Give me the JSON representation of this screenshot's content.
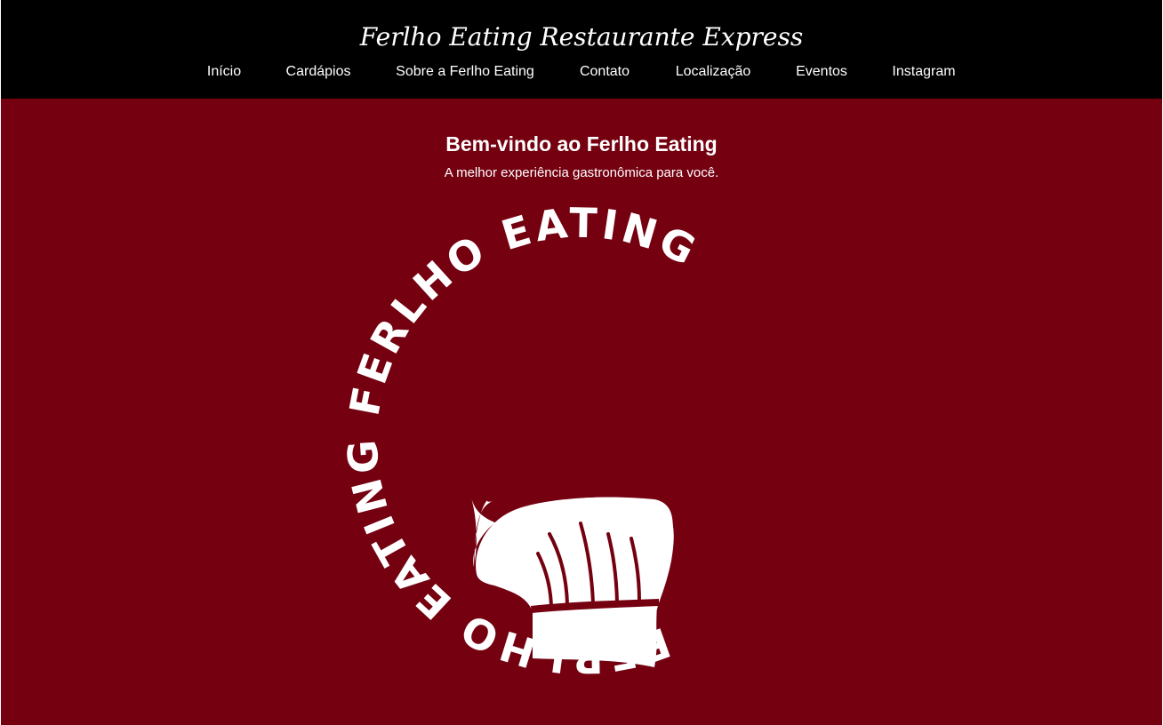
{
  "header": {
    "site_title": "Ferlho Eating Restaurante Express",
    "nav": [
      {
        "label": "Início"
      },
      {
        "label": "Cardápios"
      },
      {
        "label": "Sobre a Ferlho Eating"
      },
      {
        "label": "Contato"
      },
      {
        "label": "Localização"
      },
      {
        "label": "Eventos"
      },
      {
        "label": "Instagram"
      }
    ]
  },
  "hero": {
    "title": "Bem-vindo ao Ferlho Eating",
    "subtitle": "A melhor experiência gastronômica para você."
  },
  "logo": {
    "ring_text": "FERLHO EATING FERLHO EATING",
    "icon": "chef-hat-icon"
  },
  "colors": {
    "header_bg": "#000000",
    "main_bg": "#740010",
    "text": "#ffffff"
  }
}
